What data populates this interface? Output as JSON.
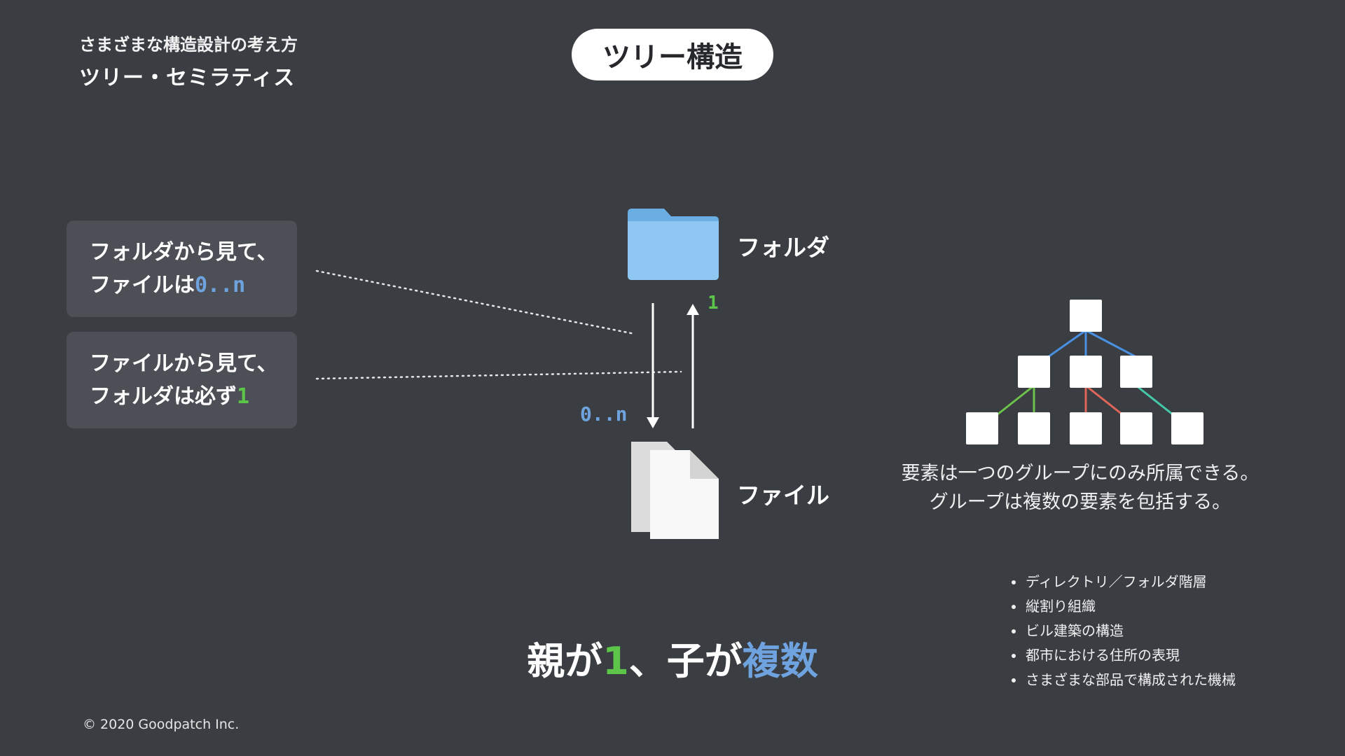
{
  "header": {
    "subtitle": "さまざまな構造設計の考え方",
    "title": "ツリー・セミラティス",
    "pill": "ツリー構造"
  },
  "cards": [
    {
      "line1": "フォルダから見て、",
      "line2_prefix": "ファイルは",
      "line2_value": "0..n"
    },
    {
      "line1": "ファイルから見て、",
      "line2_prefix": "フォルダは必ず",
      "line2_value": "1"
    }
  ],
  "diagram": {
    "folder_label": "フォルダ",
    "file_label": "ファイル",
    "up_multiplicity": "1",
    "down_multiplicity": "0..n"
  },
  "tree": {
    "description_line1": "要素は一つのグループにのみ所属できる。",
    "description_line2": "グループは複数の要素を包括する。",
    "edge_colors": [
      "#4a90e2",
      "#6cc24a",
      "#e0665a",
      "#45c9a8"
    ]
  },
  "examples": [
    "ディレクトリ／フォルダ階層",
    "縦割り組織",
    "ビル建築の構造",
    "都市における住所の表現",
    "さまざまな部品で構成された機械"
  ],
  "headline": {
    "part1": "親が",
    "part2": "1",
    "part3": "、子が",
    "part4": "複数"
  },
  "footer": {
    "copyright": "© 2020 Goodpatch Inc."
  },
  "colors": {
    "background": "#3a3d42",
    "card": "#4c4f55",
    "accent_blue": "#6fa3e0",
    "accent_green": "#5cc54a"
  }
}
